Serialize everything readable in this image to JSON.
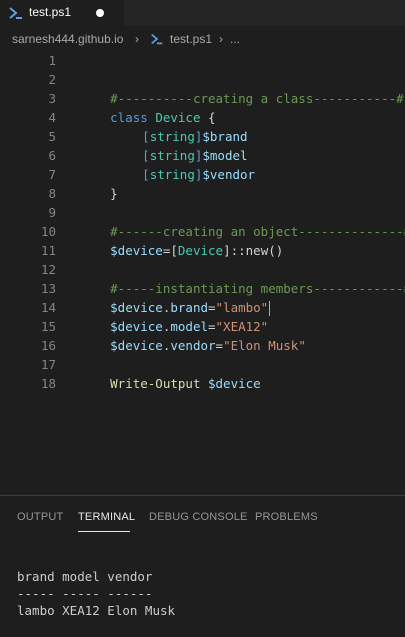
{
  "tab": {
    "label": "test.ps1"
  },
  "breadcrumb": {
    "folder": "sarnesh444.github.io",
    "file": "test.ps1",
    "more": "..."
  },
  "code": {
    "line_numbers": [
      "1",
      "2",
      "3",
      "4",
      "5",
      "6",
      "7",
      "8",
      "9",
      "10",
      "11",
      "12",
      "13",
      "14",
      "15",
      "16",
      "17",
      "18"
    ],
    "l2": "#----------creating a class-----------#",
    "l3_kw": "class",
    "l3_name": "Device",
    "l3_brace": " {",
    "l4_br1": "[",
    "l4_type": "string",
    "l4_br2": "]",
    "l4_var": "$brand",
    "l5_br1": "[",
    "l5_type": "string",
    "l5_br2": "]",
    "l5_var": "$model",
    "l6_br1": "[",
    "l6_type": "string",
    "l6_br2": "]",
    "l6_var": "$vendor",
    "l7": "}",
    "l9": "#------creating an object--------------#",
    "l10_var": "$device",
    "l10_eq": "=[",
    "l10_type": "Device",
    "l10_rest": "]::new()",
    "l12": "#-----instantiating members------------#",
    "l13_var": "$device",
    "l13_prop": ".brand",
    "l13_eq": "=",
    "l13_str": "\"lambo\"",
    "l14_var": "$device",
    "l14_prop": ".model",
    "l14_eq": "=",
    "l14_str": "\"XEA12\"",
    "l15_var": "$device",
    "l15_prop": ".vendor",
    "l15_eq": "=",
    "l15_str": "\"Elon Musk\"",
    "l17_func": "Write-Output",
    "l17_var": "$device"
  },
  "panel": {
    "tabs": [
      "OUTPUT",
      "TERMINAL",
      "DEBUG CONSOLE",
      "PROBLEMS"
    ]
  },
  "terminal": {
    "lines": [
      "brand model vendor",
      "----- ----- ------",
      "lambo XEA12 Elon Musk"
    ]
  },
  "colors": {
    "comment": "#6a9955",
    "keyword": "#569cd6",
    "type": "#4ec9b0",
    "variable": "#9cdcfe",
    "string": "#ce9178",
    "function": "#dcdcaa"
  }
}
